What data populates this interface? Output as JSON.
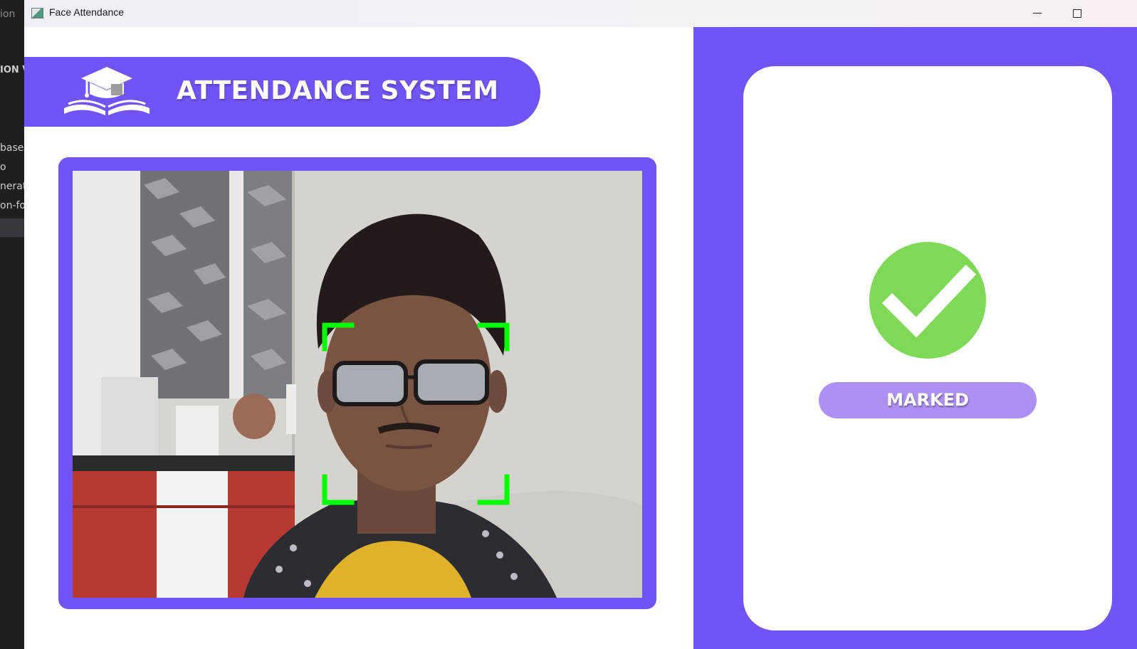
{
  "background_editor": {
    "fragments": [
      "ion",
      "ION V",
      "base.",
      "o",
      "nerat",
      "on-fo"
    ]
  },
  "window": {
    "title": "Face Attendance",
    "icons": {
      "app": "app-window-icon",
      "minimize": "minimize-icon",
      "maximize": "maximize-icon"
    }
  },
  "header": {
    "title": "ATTENDANCE SYSTEM",
    "logo": "graduation-cap-book-logo"
  },
  "camera": {
    "feed": "webcam-feed",
    "face_box_color": "#00ff00"
  },
  "status": {
    "icon": "check-circle-icon",
    "label": "MARKED",
    "colors": {
      "check": "#7ed957",
      "pill": "#ad90f4"
    }
  },
  "colors": {
    "accent": "#7253f6",
    "white": "#ffffff"
  }
}
